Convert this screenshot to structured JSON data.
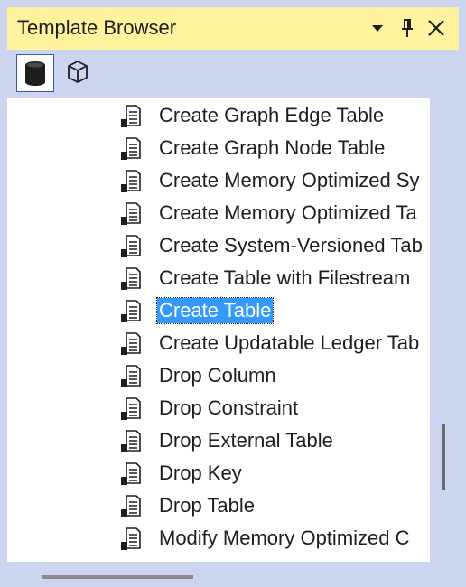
{
  "panel": {
    "title": "Template Browser",
    "buttons": [
      "dropdown-icon",
      "pin-icon",
      "close-icon"
    ]
  },
  "toolbar": {
    "tools": [
      {
        "name": "database-engine-icon",
        "active": true
      },
      {
        "name": "analysis-services-cube-icon",
        "active": false
      }
    ]
  },
  "tree": {
    "items": [
      {
        "label": "Create Graph Edge Table",
        "icon": "template-file-icon",
        "selected": false
      },
      {
        "label": "Create Graph Node Table",
        "icon": "template-file-icon",
        "selected": false
      },
      {
        "label": "Create Memory Optimized Sy",
        "icon": "template-file-icon",
        "selected": false
      },
      {
        "label": "Create Memory Optimized Ta",
        "icon": "template-file-icon",
        "selected": false
      },
      {
        "label": "Create System-Versioned Tab",
        "icon": "template-file-icon",
        "selected": false
      },
      {
        "label": "Create Table with Filestream",
        "icon": "template-file-icon",
        "selected": false
      },
      {
        "label": "Create Table",
        "icon": "template-file-icon",
        "selected": true
      },
      {
        "label": "Create Updatable Ledger Tab",
        "icon": "template-file-icon",
        "selected": false
      },
      {
        "label": "Drop Column",
        "icon": "template-file-icon",
        "selected": false
      },
      {
        "label": "Drop Constraint",
        "icon": "template-file-icon",
        "selected": false
      },
      {
        "label": "Drop External Table",
        "icon": "template-file-icon",
        "selected": false
      },
      {
        "label": "Drop Key",
        "icon": "template-file-icon",
        "selected": false
      },
      {
        "label": "Drop Table",
        "icon": "template-file-icon",
        "selected": false
      },
      {
        "label": "Modify Memory Optimized C",
        "icon": "template-file-icon",
        "selected": false
      }
    ]
  },
  "colors": {
    "title_bar": "#fff29d",
    "frame": "#ccd5f0",
    "selection": "#3399ff",
    "text": "#1e1e1e"
  }
}
